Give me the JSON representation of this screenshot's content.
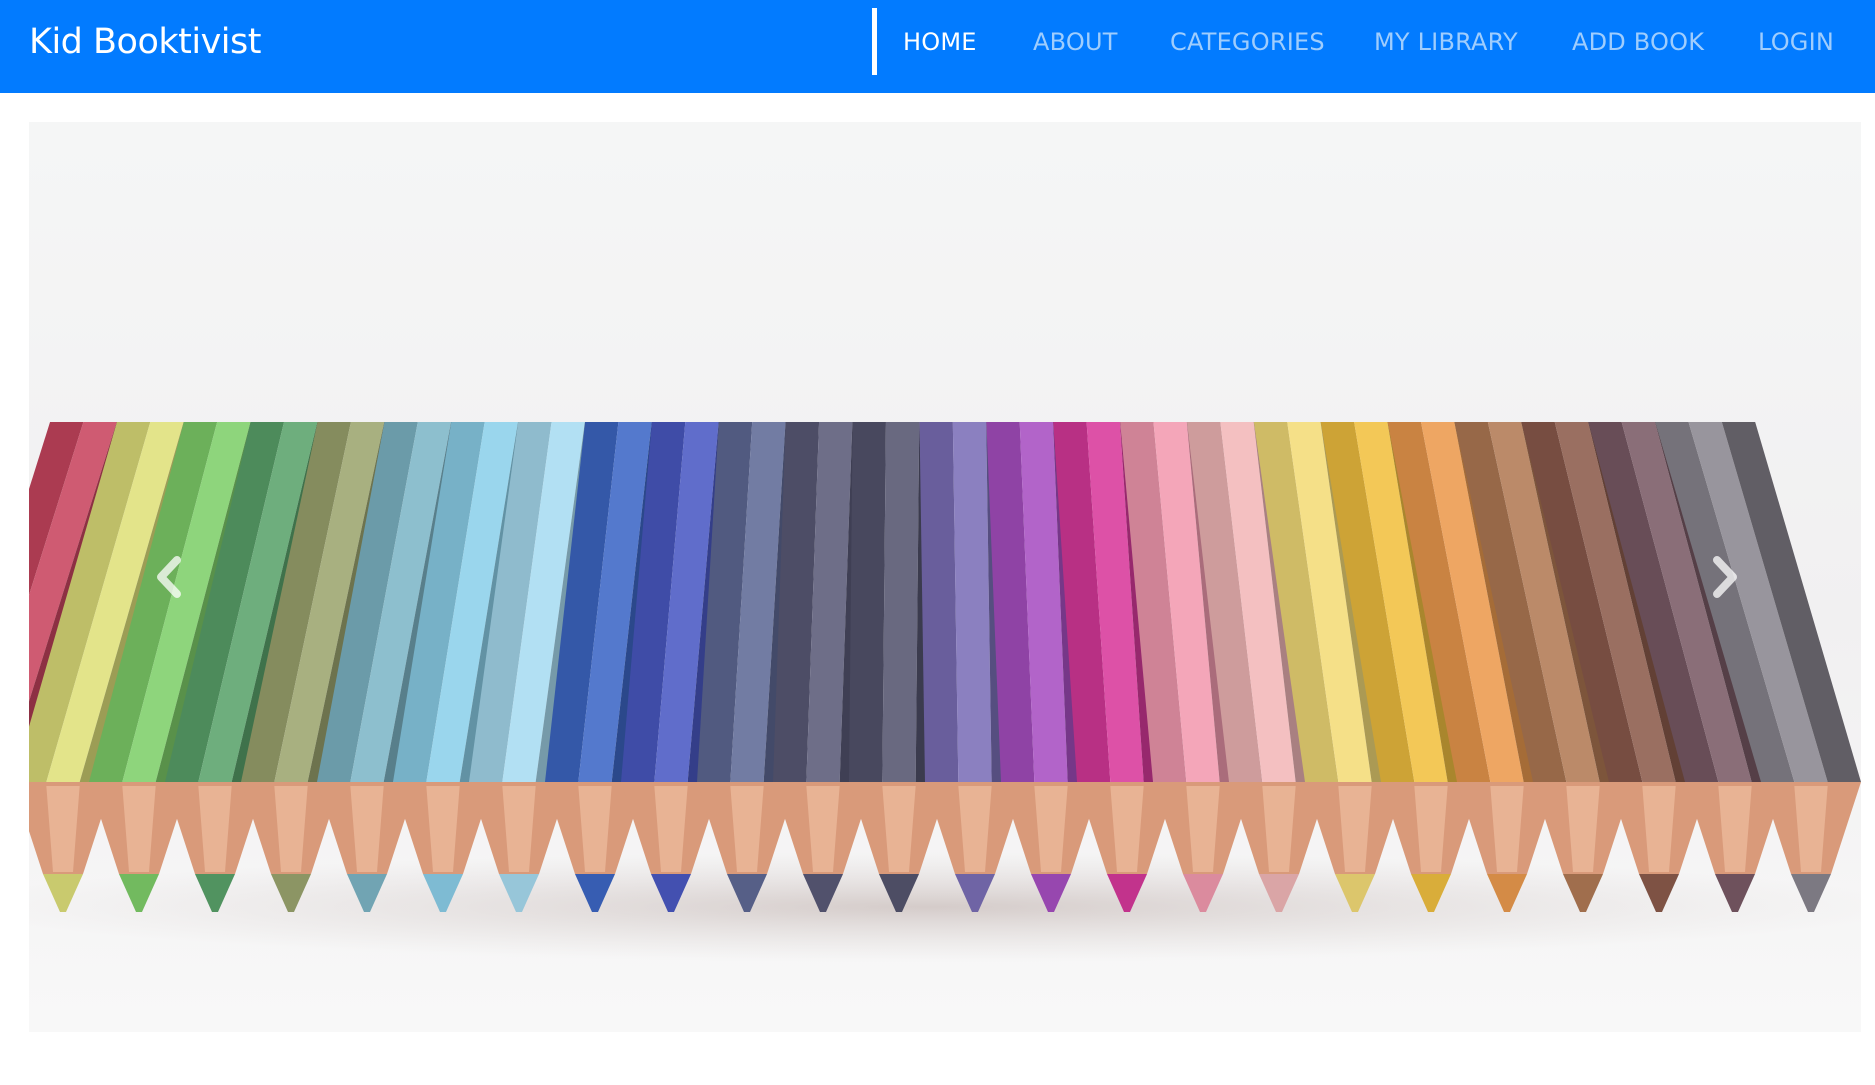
{
  "navbar": {
    "brand": "Kid Booktivist",
    "background_color": "#027bff",
    "items": [
      {
        "label": "HOME",
        "active": true
      },
      {
        "label": "ABOUT",
        "active": false
      },
      {
        "label": "CATEGORIES",
        "active": false
      },
      {
        "label": "MY LIBRARY",
        "active": false
      },
      {
        "label": "ADD BOOK",
        "active": false
      },
      {
        "label": "LOGIN",
        "active": false
      }
    ]
  },
  "carousel": {
    "slide_image": "colored-pencils-photo",
    "prev_icon": "chevron-left-icon",
    "next_icon": "chevron-right-icon",
    "pencil_colors": [
      "#c9455f",
      "#dfe07a",
      "#7fcf6a",
      "#5aa36b",
      "#9ca56f",
      "#7eb6c7",
      "#8cd0ea",
      "#a8dcf1",
      "#3d67c6",
      "#4a59c4",
      "#5f6a96",
      "#5a5a78",
      "#55556f",
      "#7b6fb7",
      "#a84fc2",
      "#d8399b",
      "#f39ab0",
      "#f2b7b8",
      "#f4dc78",
      "#f1c040",
      "#ec9a4e",
      "#b27a55",
      "#8c5b4c",
      "#7a5a66",
      "#8a8690"
    ]
  }
}
